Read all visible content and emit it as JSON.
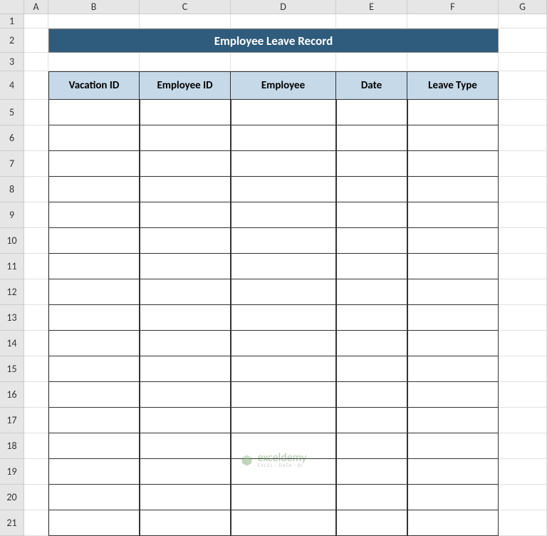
{
  "columns": [
    "A",
    "B",
    "C",
    "D",
    "E",
    "F",
    "G"
  ],
  "rows": [
    "1",
    "2",
    "3",
    "4",
    "5",
    "6",
    "7",
    "8",
    "9",
    "10",
    "11",
    "12",
    "13",
    "14",
    "15",
    "16",
    "17",
    "18",
    "19",
    "20",
    "21"
  ],
  "title": "Employee Leave Record",
  "headers": [
    "Vacation ID",
    "Employee ID",
    "Employee",
    "Date",
    "Leave Type"
  ],
  "watermark": {
    "brand": "exceldemy",
    "tagline": "EXCEL · DATA · BI"
  },
  "colors": {
    "titleBg": "#2f5b7c",
    "headerBg": "#c5d9e8"
  }
}
